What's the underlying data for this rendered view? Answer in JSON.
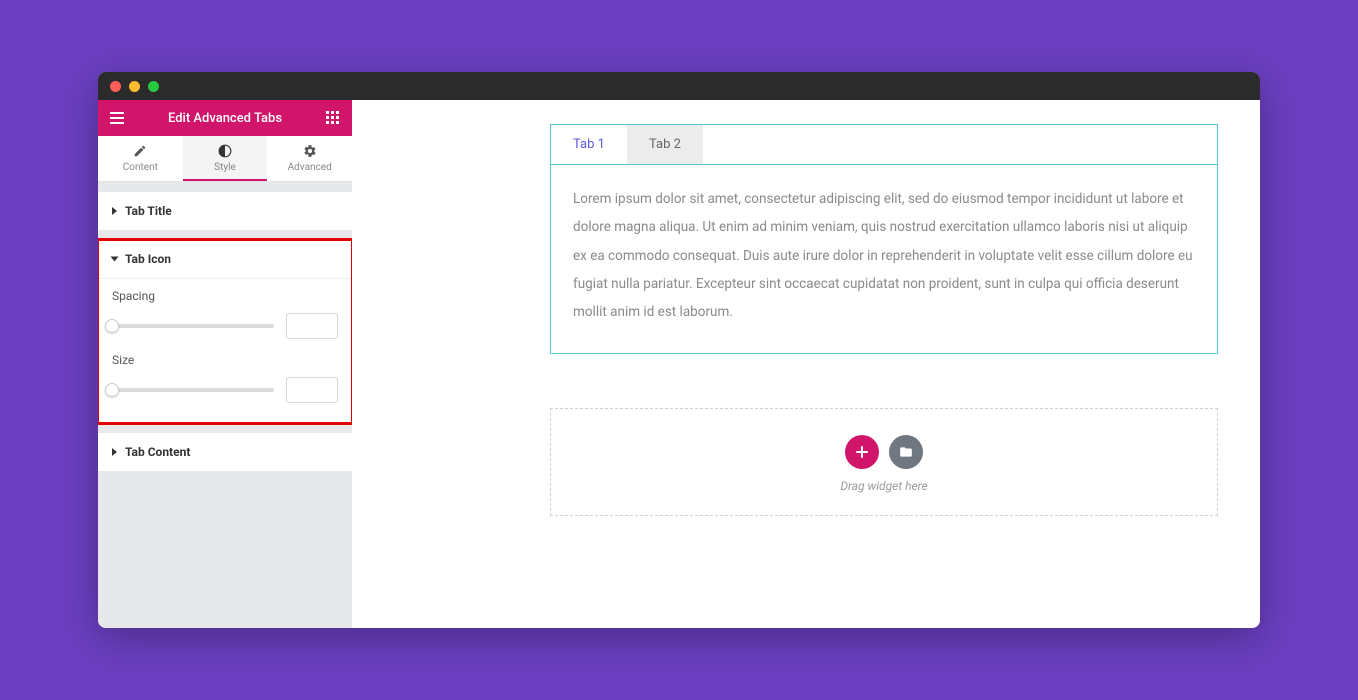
{
  "panel": {
    "title": "Edit Advanced Tabs",
    "tabs": {
      "content": "Content",
      "style": "Style",
      "advanced": "Advanced"
    },
    "sections": {
      "tab_title": "Tab Title",
      "tab_icon": "Tab Icon",
      "tab_content": "Tab Content"
    },
    "controls": {
      "spacing_label": "Spacing",
      "spacing_value": "",
      "size_label": "Size",
      "size_value": ""
    }
  },
  "preview": {
    "tabs": {
      "tab1": "Tab 1",
      "tab2": "Tab 2"
    },
    "content": "Lorem ipsum dolor sit amet, consectetur adipiscing elit, sed do eiusmod tempor incididunt ut labore et dolore magna aliqua. Ut enim ad minim veniam, quis nostrud exercitation ullamco laboris nisi ut aliquip ex ea commodo consequat. Duis aute irure dolor in reprehenderit in voluptate velit esse cillum dolore eu fugiat nulla pariatur. Excepteur sint occaecat cupidatat non proident, sunt in culpa qui officia deserunt mollit anim id est laborum.",
    "dropzone_text": "Drag widget here"
  }
}
